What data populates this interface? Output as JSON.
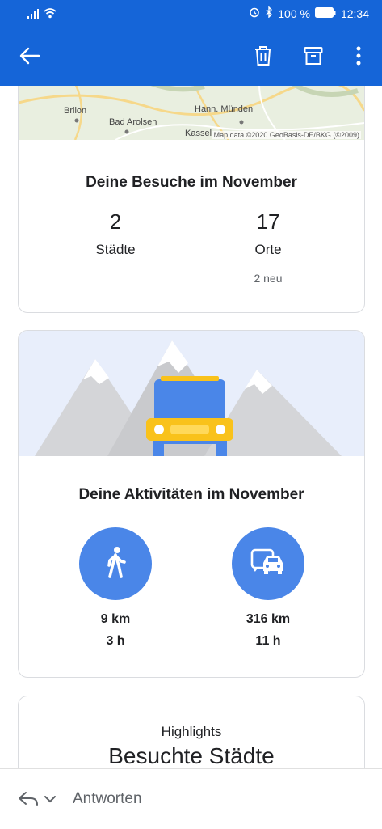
{
  "status_bar": {
    "battery": "100 %",
    "time": "12:34"
  },
  "app_bar": {
    "back_icon": "arrow-left-icon",
    "delete_icon": "trash-icon",
    "archive_icon": "archive-icon",
    "more_icon": "more-vert-icon"
  },
  "map": {
    "labels": [
      "Brilon",
      "Bad Arolsen",
      "Hann. Münden",
      "Kassel"
    ],
    "attribution": "Map data ©2020 GeoBasis-DE/BKG (©2009)"
  },
  "visits_card": {
    "title": "Deine Besuche im November",
    "cities_count": "2",
    "cities_label": "Städte",
    "places_count": "17",
    "places_label": "Orte",
    "places_new": "2 neu"
  },
  "activities_card": {
    "title": "Deine Aktivitäten im November",
    "walking": {
      "icon": "walking-icon",
      "distance": "9 km",
      "duration": "3 h"
    },
    "driving": {
      "icon": "car-transit-icon",
      "distance": "316 km",
      "duration": "11 h"
    }
  },
  "highlights_card": {
    "kicker": "Highlights",
    "title": "Besuchte Städte"
  },
  "bottom_bar": {
    "reply_label": "Antworten"
  },
  "colors": {
    "primary": "#1565d8",
    "accent_circle": "#4a86e8",
    "illustration_bg": "#e8eefb"
  }
}
